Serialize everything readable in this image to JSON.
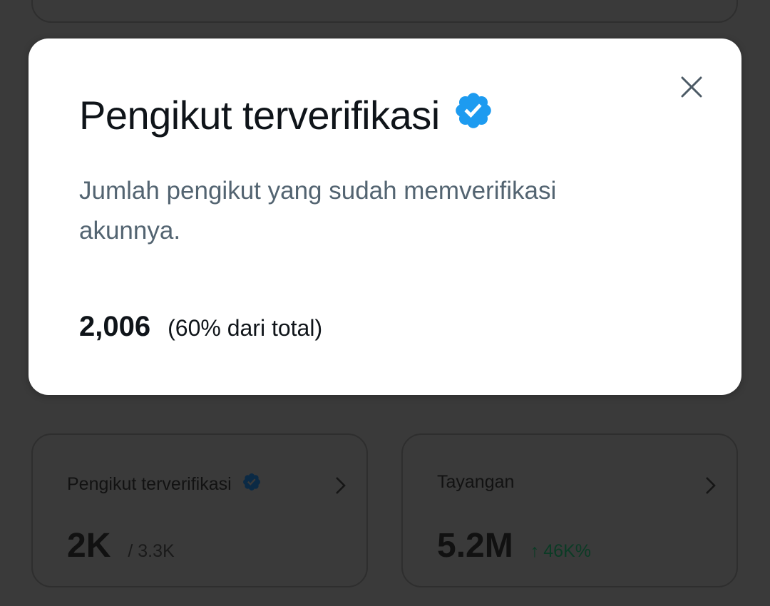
{
  "modal": {
    "title": "Pengikut terverifikasi",
    "description": "Jumlah pengikut yang sudah memverifikasi akunnya.",
    "stat_value": "2,006",
    "stat_percent": "(60% dari total)",
    "icons": {
      "badge": "verified-badge-icon",
      "close": "close-icon"
    },
    "colors": {
      "badge": "#1d9bf0",
      "description": "#536471"
    }
  },
  "cards": [
    {
      "title": "Pengikut terverifikasi",
      "value": "2K",
      "sub": "/ 3.3K",
      "icons": {
        "badge": "verified-badge-icon",
        "chevron": "chevron-right-icon"
      }
    },
    {
      "title": "Tayangan",
      "value": "5.2M",
      "delta_arrow": "↑",
      "delta": "46K%",
      "icons": {
        "chevron": "chevron-right-icon"
      },
      "colors": {
        "delta": "#00ba7c"
      }
    }
  ]
}
